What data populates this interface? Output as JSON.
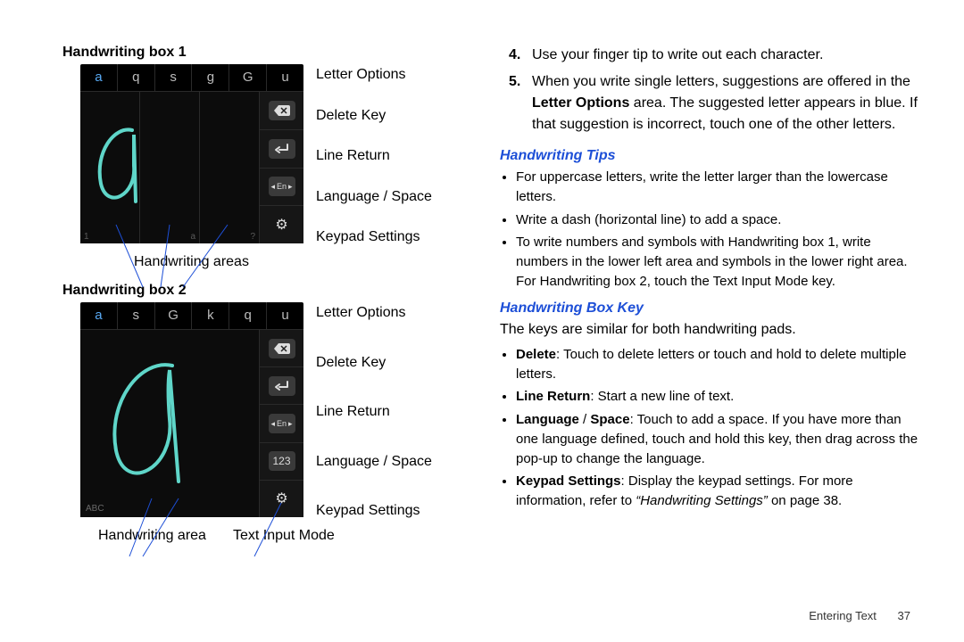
{
  "left": {
    "box1": {
      "title": "Handwriting box 1",
      "suggestions": [
        "a",
        "q",
        "s",
        "g",
        "G",
        "u"
      ],
      "hints": {
        "lowerLeftSmall": "1",
        "centerSmall": "a",
        "lowerRightSmall": "?"
      },
      "underLabel": "Handwriting areas"
    },
    "box2": {
      "title": "Handwriting box 2",
      "suggestions": [
        "a",
        "s",
        "G",
        "k",
        "q",
        "u"
      ],
      "modeKeyLabel": "123",
      "abcHint": "ABC",
      "underLabelLeft": "Handwriting area",
      "underLabelRight": "Text Input Mode"
    },
    "sideLabels": {
      "letterOptions": "Letter Options",
      "deleteKey": "Delete Key",
      "lineReturn": "Line Return",
      "languageSpace": "Language / Space",
      "keypadSettings": "Keypad Settings"
    },
    "langKeyText": "En"
  },
  "right": {
    "step4": "Use your finger tip to write out each character.",
    "step5_a": "When you write single letters, suggestions are offered in the ",
    "step5_bold": "Letter Options",
    "step5_b": " area. The suggested letter appears in blue. If that suggestion is incorrect, touch one of the other letters.",
    "tipsHeading": "Handwriting Tips",
    "tips": [
      "For uppercase letters, write the letter larger than the lowercase letters.",
      "Write a dash (horizontal line) to add a space.",
      "To write numbers and symbols with Handwriting box 1, write numbers in the lower left area and symbols in the lower right area. For Handwriting box 2, touch the Text Input Mode key."
    ],
    "boxKeyHeading": "Handwriting Box Key",
    "boxKeyIntro": "The keys are similar for both handwriting pads.",
    "boxKeyItems": {
      "delete": {
        "label": "Delete",
        "text": ": Touch to delete letters or touch and hold to delete multiple letters."
      },
      "lineReturn": {
        "label": "Line Return",
        "text": ": Start a new line of text."
      },
      "language": {
        "label": "Language",
        "sep": " / ",
        "label2": "Space",
        "text": ": Touch to add a space. If you have more than one language defined, touch and hold this key, then drag across the pop-up to change the language."
      },
      "keypad": {
        "label": "Keypad Settings",
        "text": ": Display the keypad settings. For more information, refer to ",
        "refTitle": "“Handwriting Settings”",
        "refTail": "  on page 38."
      }
    }
  },
  "footer": {
    "section": "Entering Text",
    "page": "37"
  }
}
